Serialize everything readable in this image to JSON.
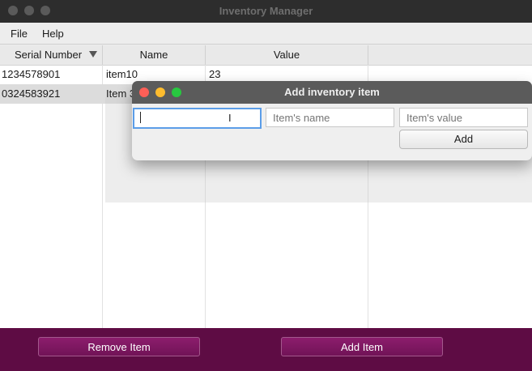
{
  "window": {
    "title": "Inventory Manager"
  },
  "menu": {
    "file": "File",
    "help": "Help"
  },
  "table": {
    "columns": [
      "Serial Number",
      "Name",
      "Value"
    ],
    "sort_icon": "sort-down-icon",
    "rows": [
      {
        "serial": "1234578901",
        "name": "item10",
        "value": "23"
      },
      {
        "serial": "0324583921",
        "name": "Item 3",
        "value": ""
      }
    ]
  },
  "bottom": {
    "remove_label": "Remove Item",
    "add_label": "Add Item"
  },
  "dialog": {
    "title": "Add inventory item",
    "serial_value": "",
    "name_placeholder": "Item's name",
    "value_placeholder": "Item's value",
    "add_label": "Add"
  },
  "colors": {
    "accent_bar": "#5e0c44",
    "button": "#711357",
    "focus_ring": "#5b9de8"
  }
}
